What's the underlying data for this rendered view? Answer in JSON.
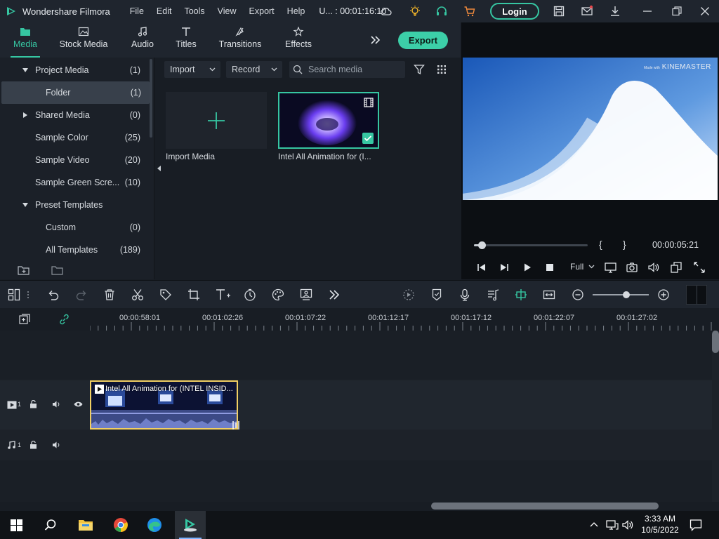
{
  "app": {
    "title": "Wondershare Filmora",
    "project": "U... : 00:01:16:10",
    "login": "Login"
  },
  "menu": [
    "File",
    "Edit",
    "Tools",
    "View",
    "Export",
    "Help"
  ],
  "tabs": [
    {
      "label": "Media",
      "icon": "folder-icon",
      "active": true
    },
    {
      "label": "Stock Media",
      "icon": "image-icon"
    },
    {
      "label": "Audio",
      "icon": "music-note-icon"
    },
    {
      "label": "Titles",
      "icon": "text-icon"
    },
    {
      "label": "Transitions",
      "icon": "transition-icon"
    },
    {
      "label": "Effects",
      "icon": "effects-icon"
    }
  ],
  "export_label": "Export",
  "sidebar": {
    "items": [
      {
        "label": "Project Media",
        "count": "(1)"
      },
      {
        "label": "Folder",
        "count": "(1)"
      },
      {
        "label": "Shared Media",
        "count": "(0)"
      },
      {
        "label": "Sample Color",
        "count": "(25)"
      },
      {
        "label": "Sample Video",
        "count": "(20)"
      },
      {
        "label": "Sample Green Scre...",
        "count": "(10)"
      },
      {
        "label": "Preset Templates",
        "count": ""
      },
      {
        "label": "Custom",
        "count": "(0)"
      },
      {
        "label": "All Templates",
        "count": "(189)"
      }
    ]
  },
  "media": {
    "import_label": "Import",
    "record_label": "Record",
    "search_placeholder": "Search media",
    "import_media_label": "Import Media",
    "clip_label": "Intel All Animation for (I..."
  },
  "preview": {
    "watermark_small": "Made with",
    "watermark_big": "KINEMASTER",
    "timecode": "00:00:05:21",
    "zoom": "Full",
    "mark_in": "{",
    "mark_out": "}",
    "progress": 0.07
  },
  "ruler": {
    "ticks": [
      "00:00:58:01",
      "00:01:02:26",
      "00:01:07:22",
      "00:01:12:17",
      "00:01:17:12",
      "00:01:22:07",
      "00:01:27:02"
    ]
  },
  "timeline": {
    "video_track": "1",
    "audio_track": "1",
    "clip_title": "Intel  All Animation for (INTEL INSID...",
    "zoom_level": 0.6
  },
  "taskbar": {
    "time": "3:33 AM",
    "date": "10/5/2022"
  },
  "colors": {
    "accent": "#36c6a2",
    "clip_border": "#f1cf63"
  }
}
